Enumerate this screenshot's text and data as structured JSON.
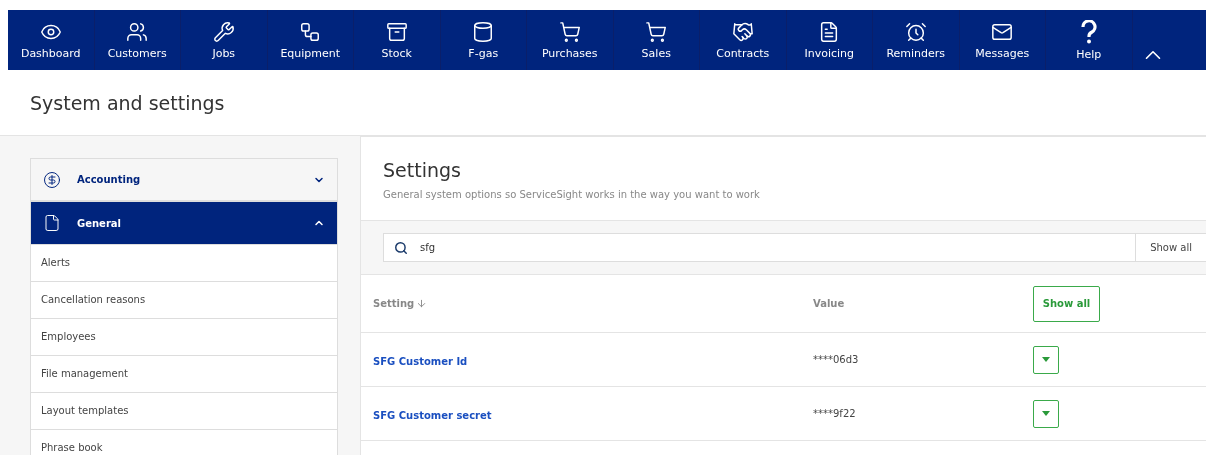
{
  "nav": [
    {
      "label": "Dashboard"
    },
    {
      "label": "Customers"
    },
    {
      "label": "Jobs"
    },
    {
      "label": "Equipment"
    },
    {
      "label": "Stock"
    },
    {
      "label": "F-gas"
    },
    {
      "label": "Purchases"
    },
    {
      "label": "Sales"
    },
    {
      "label": "Contracts"
    },
    {
      "label": "Invoicing"
    },
    {
      "label": "Reminders"
    },
    {
      "label": "Messages"
    },
    {
      "label": "Help"
    }
  ],
  "page_title": "System and settings",
  "sidebar": {
    "sections": [
      {
        "label": "Accounting",
        "expanded": false
      },
      {
        "label": "General",
        "expanded": true,
        "items": [
          "Alerts",
          "Cancellation reasons",
          "Employees",
          "File management",
          "Layout templates",
          "Phrase book"
        ]
      }
    ]
  },
  "settings": {
    "title": "Settings",
    "subtitle": "General system options so ServiceSight works in the way you want to work",
    "search": {
      "value": "sfg",
      "button": "Show all"
    },
    "table": {
      "columns": [
        "Setting",
        "Value"
      ],
      "header_button": "Show all",
      "rows": [
        {
          "setting": "SFG Customer Id",
          "value": "****06d3"
        },
        {
          "setting": "SFG Customer secret",
          "value": "****9f22"
        }
      ]
    }
  }
}
